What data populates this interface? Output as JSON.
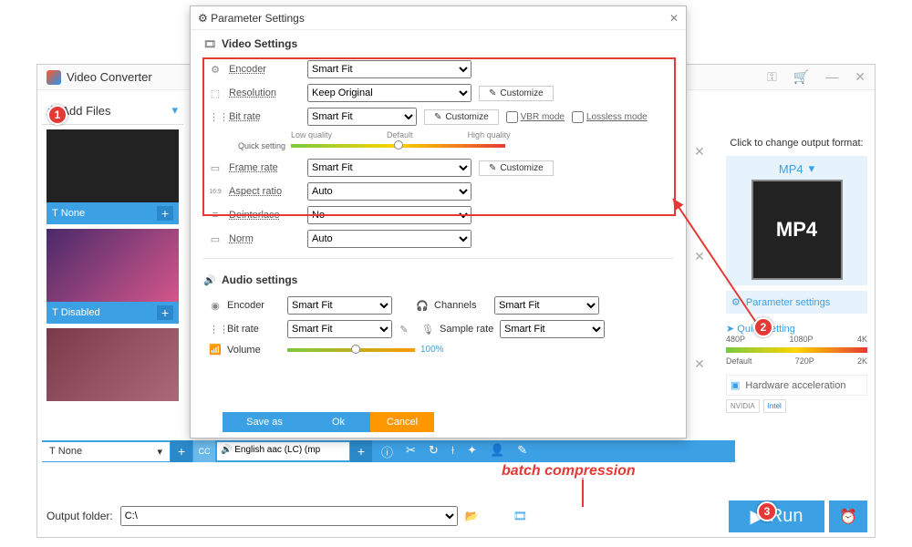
{
  "app_title": "Video Converter",
  "dialog": {
    "title": "Parameter Settings",
    "video_section": "Video Settings",
    "audio_section": "Audio settings",
    "labels": {
      "encoder": "Encoder",
      "resolution": "Resolution",
      "bitrate": "Bit rate",
      "framerate": "Frame rate",
      "aspect": "Aspect ratio",
      "deinterlace": "Deinterlace",
      "norm": "Norm",
      "quick_setting": "Quick setting",
      "low_q": "Low quality",
      "default_q": "Default",
      "high_q": "High quality",
      "channels": "Channels",
      "samplerate": "Sample rate",
      "volume": "Volume"
    },
    "values": {
      "encoder": "Smart Fit",
      "resolution": "Keep Original",
      "bitrate": "Smart Fit",
      "framerate": "Smart Fit",
      "aspect": "Auto",
      "deinterlace": "No",
      "norm": "Auto",
      "a_encoder": "Smart Fit",
      "a_bitrate": "Smart Fit",
      "channels": "Smart Fit",
      "samplerate": "Smart Fit",
      "volume_pct": "100%"
    },
    "customize": "Customize",
    "vbr": "VBR mode",
    "lossless": "Lossless mode",
    "save_as": "Save as",
    "ok": "Ok",
    "cancel": "Cancel"
  },
  "left": {
    "add_files": "Add Files",
    "sel1": "None",
    "sel2": "Disabled",
    "sel3": "None",
    "lang": "English aac (LC) (mp"
  },
  "right": {
    "hdr": "Click to change output format:",
    "format": "MP4",
    "param": "Parameter settings",
    "quick": "Quick setting",
    "qs_labels": {
      "p480": "480P",
      "p720": "720P",
      "p1080": "1080P",
      "p2k": "2K",
      "p4k": "4K",
      "def": "Default"
    },
    "hw": "Hardware acceleration",
    "nvidia": "NVIDIA",
    "intel": "Intel"
  },
  "output": {
    "label": "Output folder:",
    "path": "C:\\"
  },
  "run": "Run",
  "annot": {
    "batch": "batch compression"
  }
}
